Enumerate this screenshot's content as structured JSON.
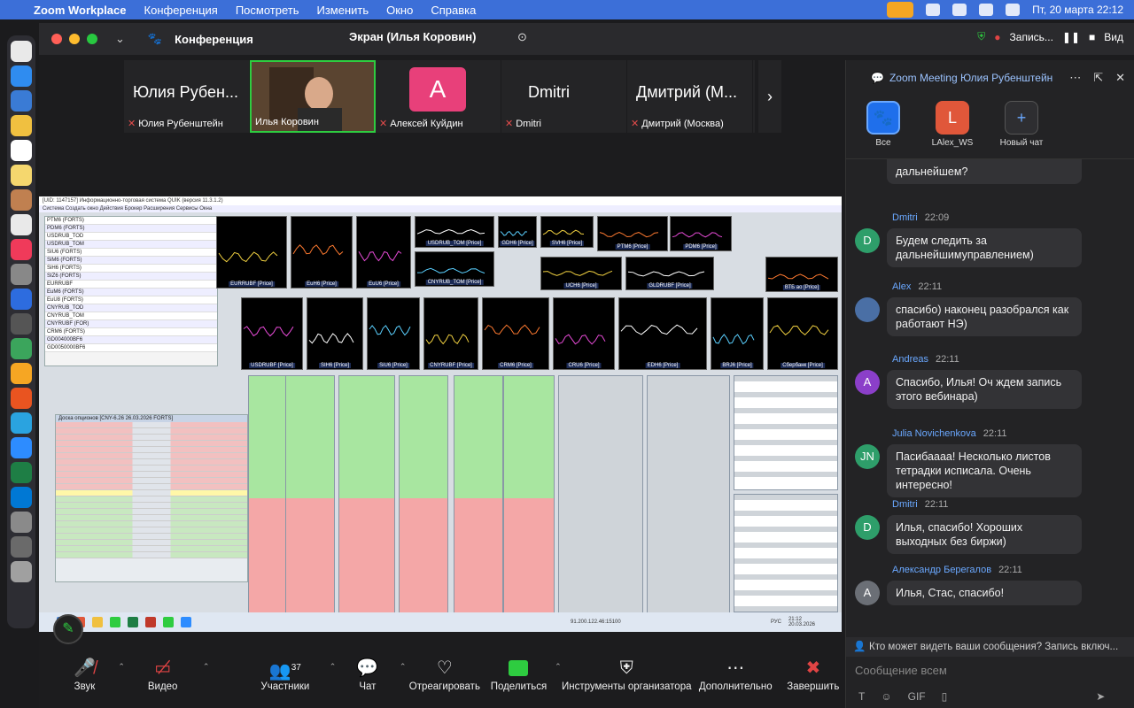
{
  "menubar": {
    "app_name": "Zoom Workplace",
    "items": [
      "Конференция",
      "Посмотреть",
      "Изменить",
      "Окно",
      "Справка"
    ],
    "date_time": "Пт, 20 марта  22:12"
  },
  "window": {
    "meeting_label": "Конференция",
    "screen_label": "Экран (Илья Коровин)",
    "recording_label": "Запись...",
    "view_label": "Вид"
  },
  "participants": [
    {
      "big": "Юлия Рубен...",
      "name": "Юлия Рубенштейн",
      "muted": true
    },
    {
      "big": "",
      "name": "Илья Коровин",
      "muted": false
    },
    {
      "big": "A",
      "name": "Алексей Куйдин",
      "muted": true
    },
    {
      "big": "Dmitri",
      "name": "Dmitri",
      "muted": true
    },
    {
      "big": "Дмитрий (М...",
      "name": "Дмитрий (Москва)",
      "muted": true
    }
  ],
  "shared_screen": {
    "title": "[UID: 1147157] Информационно-торговая система QUIK (версия 11.3.1.2)",
    "menu": "Система  Создать окно  Действия  Брокер  Расширения  Сервисы  Окна",
    "charts": [
      "EURRUBF [Price]",
      "EuH6 [Price]",
      "EuU6 [Price]",
      "USDRUB_TOM [Price]",
      "GDH6 [Price]",
      "SVH6 [Price]",
      "PTM6 [Price]",
      "PDM6 [Price]",
      "GLDRUBF [Price]",
      "CNYRUB_TOM [Price]",
      "UCH6 [Price]",
      "ВТБ ао [Price]",
      "USDRUBF [Price]",
      "SIH6 [Price]",
      "SiU6 [Price]",
      "CNYRUBF [Price]",
      "CRM6 [Price]",
      "CRU6 [Price]",
      "EDH6 [Price]",
      "BRJ6 [Price]",
      "Сбербанк [Price]"
    ],
    "left_table_rows": [
      "PTM6 (FORTS)",
      "PDM6 (FORTS)",
      "USDRUB_TOD",
      "USDRUB_TOM",
      "SIU6 (FORTS)",
      "SiM6 (FORTS)",
      "SiH6 (FORTS)",
      "SIZ6 (FORTS)",
      "EURRUBF",
      "EuM6 (FORTS)",
      "EuU8 (FORTS)",
      "CNYRUB_TOD",
      "CNYRUB_TOM",
      "CNYRUBF (FOR)",
      "CRM6 (FORTS)",
      "GD004000BF6",
      "GD0050000BF6"
    ],
    "options_title": "Доска опционов [CNY-6.26  26.03.2026  FORTS]",
    "status_ip": "91.200.122.46:15100",
    "status_date": "20.03.2026",
    "taskbar_time": "21:12",
    "taskbar_date": "20.03.2026",
    "taskbar_lang": "РУС"
  },
  "toolbar": [
    {
      "label": "Звук",
      "icon": "mic-muted-icon"
    },
    {
      "label": "Видео",
      "icon": "video-off-icon"
    },
    {
      "label": "Участники",
      "icon": "participants-icon",
      "count": "37"
    },
    {
      "label": "Чат",
      "icon": "chat-icon"
    },
    {
      "label": "Отреагировать",
      "icon": "heart-icon"
    },
    {
      "label": "Поделиться",
      "icon": "share-icon"
    },
    {
      "label": "Инструменты организатора",
      "icon": "shield-icon"
    },
    {
      "label": "Дополнительно",
      "icon": "more-icon"
    },
    {
      "label": "Завершить",
      "icon": "end-icon"
    }
  ],
  "chat": {
    "title": "Zoom Meeting Юлия Рубенштейн",
    "tabs": [
      {
        "label": "Все",
        "letter": "",
        "color": "#1f6feb"
      },
      {
        "label": "LAlex_WS",
        "letter": "L",
        "color": "#e0573a"
      },
      {
        "label": "Новый чат",
        "letter": "+",
        "color": "#2e2e31"
      }
    ],
    "partial_message": "дальнейшем?",
    "messages": [
      {
        "sender": "Dmitri",
        "time": "22:09",
        "avatar": "D",
        "color": "#2e9e6a",
        "text": "Будем следить за дальнейшимуправлением)"
      },
      {
        "sender": "Alex",
        "time": "22:11",
        "avatar": "",
        "color": "#4a6fa5",
        "text": "спасибо) наконец разобрался как работают НЭ)"
      },
      {
        "sender": "Andreas",
        "time": "22:11",
        "avatar": "A",
        "color": "#8b3fc9",
        "text": "Спасибо, Илья! Оч ждем запись этого вебинара)"
      },
      {
        "sender": "Julia Novichenkova",
        "time": "22:11",
        "avatar": "JN",
        "color": "#2e9e6a",
        "text": "Пасибаааа! Несколько листов тетрадки исписала. Очень интересно!"
      },
      {
        "sender": "Dmitri",
        "time": "22:11",
        "avatar": "D",
        "color": "#2e9e6a",
        "text": "Илья, спасибо! Хороших выходных без биржи)"
      },
      {
        "sender": "Александр Берегалов",
        "time": "22:11",
        "avatar": "A",
        "color": "#6b6f76",
        "text": "Илья, Стас, спасибо!"
      }
    ],
    "visibility_notice": "Кто может видеть ваши сообщения? Запись включ...",
    "input_placeholder": "Сообщение всем"
  },
  "colors": {
    "accent": "#2ecc40",
    "end": "#e04444",
    "menubar": "#3c6fd8",
    "chat_name": "#6aa8ff"
  }
}
